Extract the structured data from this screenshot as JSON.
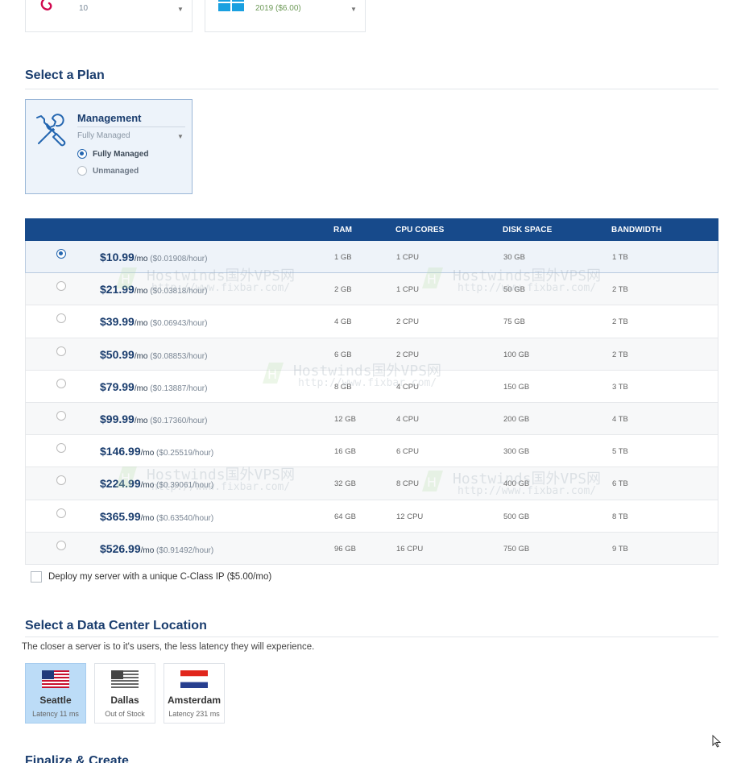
{
  "os_selectors": [
    {
      "value": "10",
      "logo": "debian-swirl-icon"
    },
    {
      "value": "2019 ($6.00)",
      "logo": "windows-logo-icon"
    }
  ],
  "plan_section": {
    "title": "Select a Plan"
  },
  "management": {
    "title": "Management",
    "selected": "Fully Managed",
    "options": [
      {
        "label": "Fully Managed",
        "checked": true
      },
      {
        "label": "Unmanaged",
        "checked": false
      }
    ]
  },
  "plan_table": {
    "headers": [
      "RAM",
      "CPU CORES",
      "DISK SPACE",
      "BANDWIDTH"
    ],
    "rows": [
      {
        "price": "$10.99",
        "per": "/mo",
        "hourly": " ($0.01908/hour)",
        "ram": "1 GB",
        "cpu": "1 CPU",
        "disk": "30 GB",
        "bandwidth": "1 TB",
        "selected": true
      },
      {
        "price": "$21.99",
        "per": "/mo",
        "hourly": " ($0.03818/hour)",
        "ram": "2 GB",
        "cpu": "1 CPU",
        "disk": "50 GB",
        "bandwidth": "2 TB",
        "selected": false
      },
      {
        "price": "$39.99",
        "per": "/mo",
        "hourly": " ($0.06943/hour)",
        "ram": "4 GB",
        "cpu": "2 CPU",
        "disk": "75 GB",
        "bandwidth": "2 TB",
        "selected": false
      },
      {
        "price": "$50.99",
        "per": "/mo",
        "hourly": " ($0.08853/hour)",
        "ram": "6 GB",
        "cpu": "2 CPU",
        "disk": "100 GB",
        "bandwidth": "2 TB",
        "selected": false
      },
      {
        "price": "$79.99",
        "per": "/mo",
        "hourly": " ($0.13887/hour)",
        "ram": "8 GB",
        "cpu": "4 CPU",
        "disk": "150 GB",
        "bandwidth": "3 TB",
        "selected": false
      },
      {
        "price": "$99.99",
        "per": "/mo",
        "hourly": " ($0.17360/hour)",
        "ram": "12 GB",
        "cpu": "4 CPU",
        "disk": "200 GB",
        "bandwidth": "4 TB",
        "selected": false
      },
      {
        "price": "$146.99",
        "per": "/mo",
        "hourly": " ($0.25519/hour)",
        "ram": "16 GB",
        "cpu": "6 CPU",
        "disk": "300 GB",
        "bandwidth": "5 TB",
        "selected": false
      },
      {
        "price": "$224.99",
        "per": "/mo",
        "hourly": " ($0.39061/hour)",
        "ram": "32 GB",
        "cpu": "8 CPU",
        "disk": "400 GB",
        "bandwidth": "6 TB",
        "selected": false
      },
      {
        "price": "$365.99",
        "per": "/mo",
        "hourly": " ($0.63540/hour)",
        "ram": "64 GB",
        "cpu": "12 CPU",
        "disk": "500 GB",
        "bandwidth": "8 TB",
        "selected": false
      },
      {
        "price": "$526.99",
        "per": "/mo",
        "hourly": " ($0.91492/hour)",
        "ram": "96 GB",
        "cpu": "16 CPU",
        "disk": "750 GB",
        "bandwidth": "9 TB",
        "selected": false
      }
    ]
  },
  "cclass": {
    "label": "Deploy my server with a unique C-Class IP ($5.00/mo)",
    "checked": false
  },
  "datacenter": {
    "title": "Select a Data Center Location",
    "description": "The closer a server is to it's users, the less latency they will experience.",
    "locations": [
      {
        "name": "Seattle",
        "sub": "Latency 11 ms",
        "flag": "us-flag-icon",
        "selected": true
      },
      {
        "name": "Dallas",
        "sub": "Out of Stock",
        "flag": "us-flag-icon",
        "selected": false
      },
      {
        "name": "Amsterdam",
        "sub": "Latency 231 ms",
        "flag": "netherlands-flag-icon",
        "selected": false
      }
    ]
  },
  "finalize": {
    "title": "Finalize & Create"
  },
  "watermark": {
    "title": "Hostwinds国外VPS网",
    "url": "http://www.fixbar.com/"
  },
  "colors": {
    "brand_navy": "#174a8b",
    "heading": "#1a3d6e",
    "selected_location": "#bcdcf7"
  }
}
